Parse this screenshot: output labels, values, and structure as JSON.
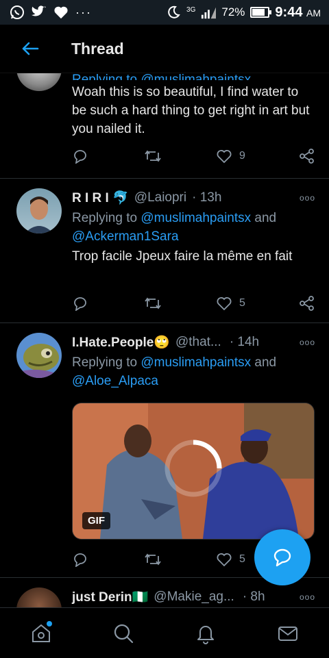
{
  "statusbar": {
    "network": "3G",
    "battery": "72%",
    "battery_level": 0.72,
    "time": "9:44",
    "ampm": "AM"
  },
  "header": {
    "title": "Thread"
  },
  "tweets": [
    {
      "reply_to": "Replying to @muslimahpaintsx",
      "text": "Woah this is so beautiful, I find water to be such a hard thing to get right in art but you nailed it.",
      "likes": "9"
    },
    {
      "name": "R I R I 🐬",
      "handle": "@Laiopri",
      "time": "· 13h",
      "reply_prefix": "Replying to ",
      "reply_user1": "@muslimahpaintsx",
      "reply_and": " and ",
      "reply_user2": "@Ackerman1Sara",
      "text": "Trop facile Jpeux faire la même en fait",
      "likes": "5"
    },
    {
      "name": "I.Hate.People🙄",
      "handle": "@that...",
      "time": "· 14h",
      "reply_prefix": "Replying to ",
      "reply_user1": "@muslimahpaintsx",
      "reply_and": " and ",
      "reply_user2": "@Aloe_Alpaca",
      "gif_label": "GIF",
      "likes": "5"
    },
    {
      "name": "just Derin🇳🇬",
      "handle": "@Makie_ag...",
      "time": "· 8h"
    }
  ],
  "colors": {
    "accent": "#1da1f2",
    "link": "#2a9df4",
    "muted": "#8b98a5"
  },
  "icons": {
    "back": "arrow-left-icon",
    "reply": "comment-icon",
    "retweet": "retweet-icon",
    "like": "heart-icon",
    "share": "share-icon",
    "compose": "compose-reply-icon",
    "nav": [
      "home-icon",
      "search-icon",
      "notifications-icon",
      "messages-icon"
    ]
  }
}
